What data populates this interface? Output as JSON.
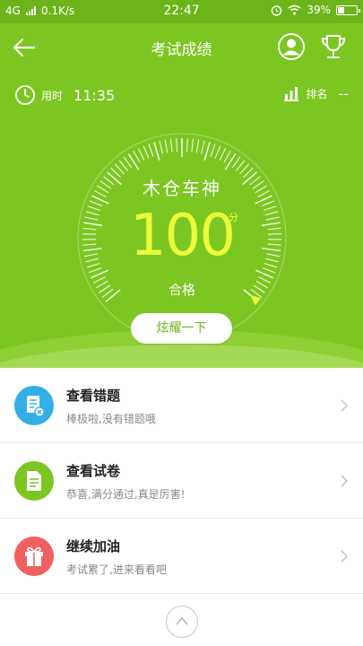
{
  "status_bar": {
    "network": "4G",
    "speed": "0.1K/s",
    "time": "22:47",
    "battery": "39%",
    "battery_level": 0.39
  },
  "header": {
    "title": "考试成绩"
  },
  "info": {
    "time_label": "用时",
    "time_value": "11:35",
    "rank_label": "排名",
    "rank_value": "--"
  },
  "score_card": {
    "name": "木仓车神",
    "score": "100",
    "unit": "分",
    "result": "合格",
    "score_fraction": 1.0,
    "button": "炫耀一下"
  },
  "list": {
    "items": [
      {
        "title": "查看错题",
        "subtitle": "棒极啦,没有错题哦",
        "icon": "wrong-questions-icon",
        "color": "#33aee6"
      },
      {
        "title": "查看试卷",
        "subtitle": "恭喜,满分通过,真是厉害!",
        "icon": "exam-paper-icon",
        "color": "#7cc622"
      },
      {
        "title": "继续加油",
        "subtitle": "考试累了,进来看看吧",
        "icon": "gift-icon",
        "color": "#f06060"
      }
    ]
  },
  "colors": {
    "brand_green": "#7cc622",
    "score_yellow": "#eaff3a"
  }
}
